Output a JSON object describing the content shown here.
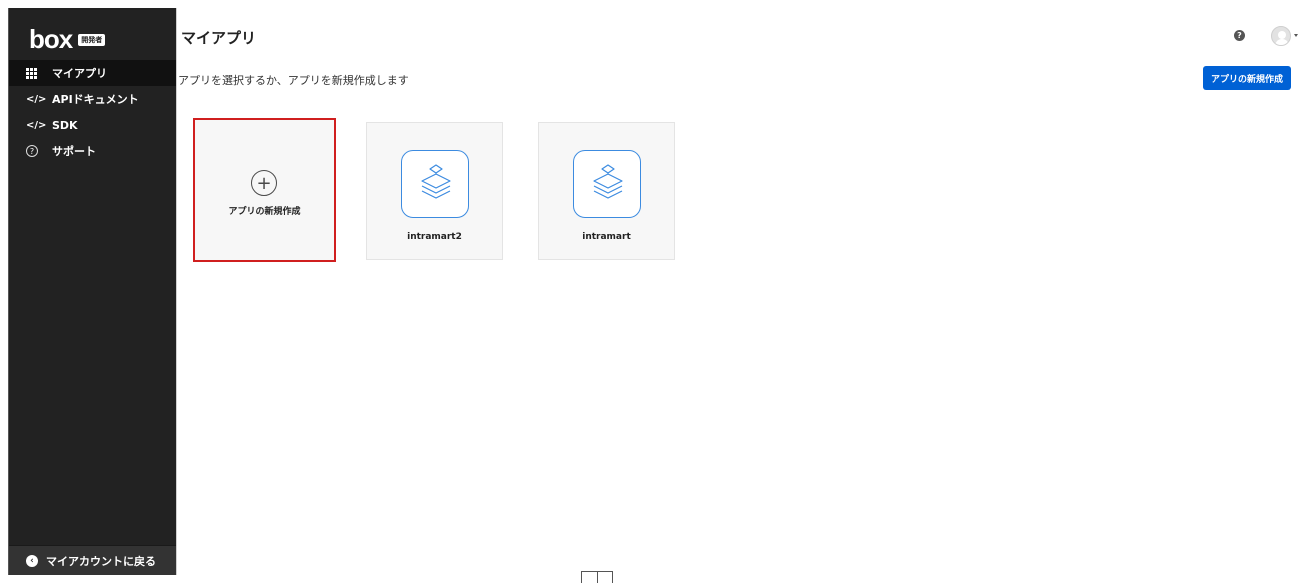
{
  "sidebar": {
    "logo": "box",
    "badge": "開発者",
    "items": [
      {
        "icon": "grid-icon",
        "label": "マイアプリ",
        "active": true
      },
      {
        "icon": "code-icon",
        "icon_text": "</>",
        "label": "APIドキュメント",
        "active": false
      },
      {
        "icon": "code-icon",
        "icon_text": "</>",
        "label": "SDK",
        "active": false
      },
      {
        "icon": "help-circle-icon",
        "icon_text": "?",
        "label": "サポート",
        "active": false
      }
    ],
    "back_label": "マイアカウントに戻る",
    "back_icon": "‹"
  },
  "header": {
    "title": "マイアプリ",
    "subtitle": "アプリを選択するか、アプリを新規作成します",
    "help_icon_text": "?",
    "new_app_button": "アプリの新規作成"
  },
  "cards": {
    "new_card_label": "アプリの新規作成",
    "plus": "+",
    "apps": [
      {
        "name": "intramart2"
      },
      {
        "name": "intramart"
      }
    ]
  },
  "colors": {
    "sidebar_bg": "#222222",
    "accent_blue": "#0061d5",
    "highlight_red": "#d01f1f",
    "app_icon_border": "#3c8be0"
  }
}
